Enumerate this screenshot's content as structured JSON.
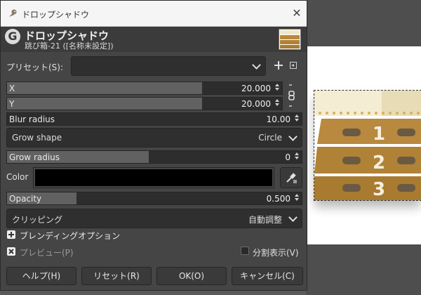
{
  "window": {
    "title": "ドロップシャドウ"
  },
  "header": {
    "title": "ドロップシャドウ",
    "subtitle": "跳び箱-21 ([名称未設定])"
  },
  "presets": {
    "label": "プリセット(S):",
    "value": ""
  },
  "x": {
    "label": "X",
    "value": "20.000"
  },
  "y": {
    "label": "Y",
    "value": "20.000"
  },
  "blur": {
    "label": "Blur radius",
    "value": "10.00"
  },
  "grow_shape": {
    "label": "Grow shape",
    "value": "Circle"
  },
  "grow_radius": {
    "label": "Grow radius",
    "value": "0"
  },
  "color": {
    "label": "Color",
    "value": "#000000"
  },
  "opacity": {
    "label": "Opacity",
    "value": "0.500"
  },
  "clipping": {
    "label": "クリッピング",
    "value": "自動調整"
  },
  "blending": {
    "label": "ブレンディングオプション"
  },
  "preview": {
    "label": "プレビュー(P)",
    "checked": true
  },
  "split": {
    "label": "分割表示(V)",
    "checked": false
  },
  "buttons": {
    "help": "ヘルプ(H)",
    "reset": "リセット(R)",
    "ok": "OK(O)",
    "cancel": "キャンセル(C)"
  },
  "canvas": {
    "numbers": [
      "1",
      "2",
      "3"
    ]
  },
  "icons": {
    "app": "gimp-wilber-icon",
    "close": "close-icon",
    "add": "plus-icon",
    "menu": "menu-icon",
    "chain": "chain-link-icon",
    "picker": "color-picker-icon"
  }
}
